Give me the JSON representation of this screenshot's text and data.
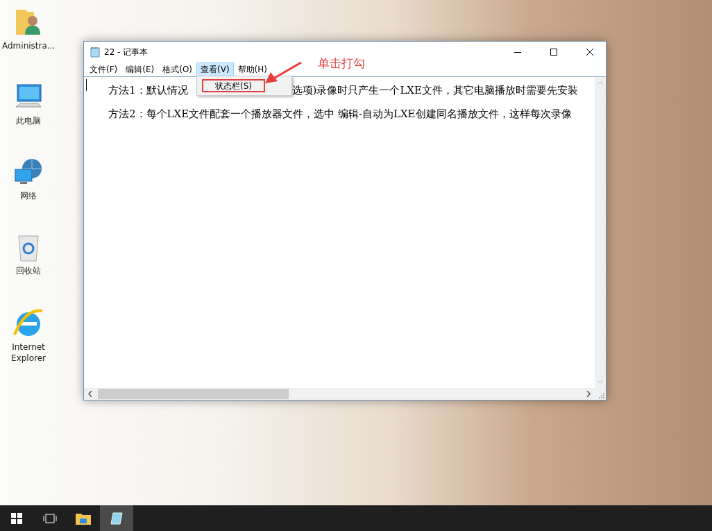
{
  "desktop_icons": [
    {
      "kind": "user-folder",
      "label": "Administra..."
    },
    {
      "kind": "computer",
      "label": "此电脑"
    },
    {
      "kind": "network",
      "label": "网络"
    },
    {
      "kind": "recycle-bin",
      "label": "回收站"
    },
    {
      "kind": "browser",
      "label": "Internet Explorer"
    }
  ],
  "window": {
    "title": "22 - 记事本",
    "menu": [
      {
        "label": "文件(F)",
        "selected": false
      },
      {
        "label": "编辑(E)",
        "selected": false
      },
      {
        "label": "格式(O)",
        "selected": false
      },
      {
        "label": "查看(V)",
        "selected": true
      },
      {
        "label": "帮助(H)",
        "selected": false
      }
    ],
    "dropdown": [
      {
        "label": "状态栏(S)",
        "highlighted": true
      }
    ],
    "lines": [
      {
        "parts": [
          "方法1：默认情况",
          "选项)录像时只产生一个LXE文件，其它电脑播放时需要先安装"
        ]
      },
      {
        "parts": [
          "方法2：每个LXE文件配套一个播放器文件，选中 编辑-自动为LXE创建同名播放文件，这样每次录像"
        ]
      }
    ]
  },
  "annotation": {
    "text": "单击打勾"
  },
  "taskbar": [
    {
      "kind": "start",
      "selected": false
    },
    {
      "kind": "task-view",
      "selected": false
    },
    {
      "kind": "explorer",
      "selected": false
    },
    {
      "kind": "notepad",
      "selected": true
    }
  ]
}
